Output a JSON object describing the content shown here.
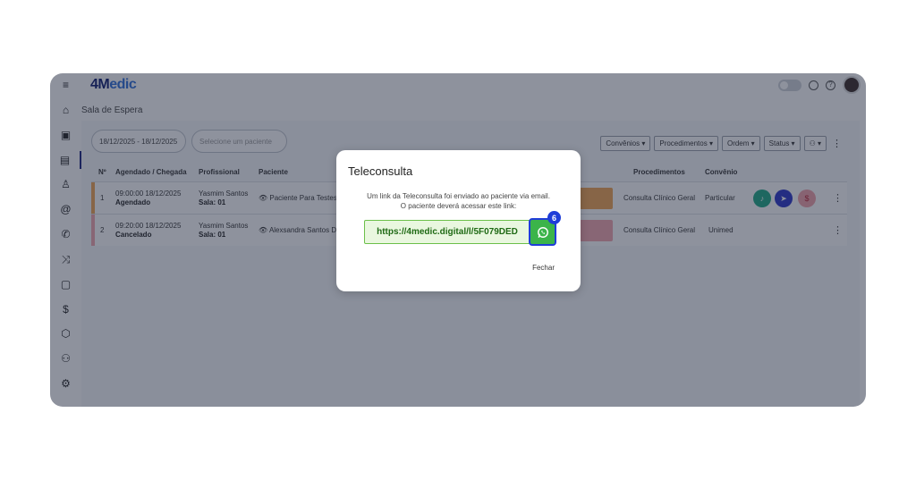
{
  "app": {
    "logo_main": "4M",
    "logo_rest": "edic"
  },
  "breadcrumb": "Sala de Espera",
  "filters": {
    "date_range": "18/12/2025 - 18/12/2025",
    "patient_placeholder": "Selecione um paciente",
    "convenios": "Convênios ▾",
    "procedimentos": "Procedimentos ▾",
    "ordem": "Ordem ▾",
    "status": "Status ▾",
    "more": "⋮"
  },
  "table": {
    "headers": {
      "num": "Nº",
      "agendado": "Agendado / Chegada",
      "profissional": "Profissional",
      "paciente": "Paciente",
      "procedimentos": "Procedimentos",
      "convenio": "Convênio"
    },
    "rows": [
      {
        "num": "1",
        "time": "09:00:00 18/12/2025",
        "status": "Agendado",
        "prof": "Yasmim Santos",
        "sala": "Sala: 01",
        "patient": "Paciente Para Testes",
        "procedure": "Consulta Clínico Geral",
        "insurance": "Particular",
        "strip_color": "#f0a552",
        "chip_color": "#f0a552"
      },
      {
        "num": "2",
        "time": "09:20:00 18/12/2025",
        "status": "Cancelado",
        "prof": "Yasmim Santos",
        "sala": "Sala: 01",
        "patient": "Alexsandra Santos D",
        "procedure": "Consulta Clínico Geral",
        "insurance": "Unimed",
        "strip_color": "#f2a7ae",
        "chip_color": "#f2a7ae"
      }
    ]
  },
  "modal": {
    "title": "Teleconsulta",
    "msg_line1": "Um link da Teleconsulta foi enviado ao paciente via email.",
    "msg_line2": "O paciente deverá acessar este link:",
    "link": "https://4medic.digital/l/5F079DED",
    "badge": "6",
    "close": "Fechar"
  },
  "colors": {
    "brand": "#1a237e",
    "whatsapp": "#3bb44a",
    "highlight": "#1f3dd8"
  }
}
